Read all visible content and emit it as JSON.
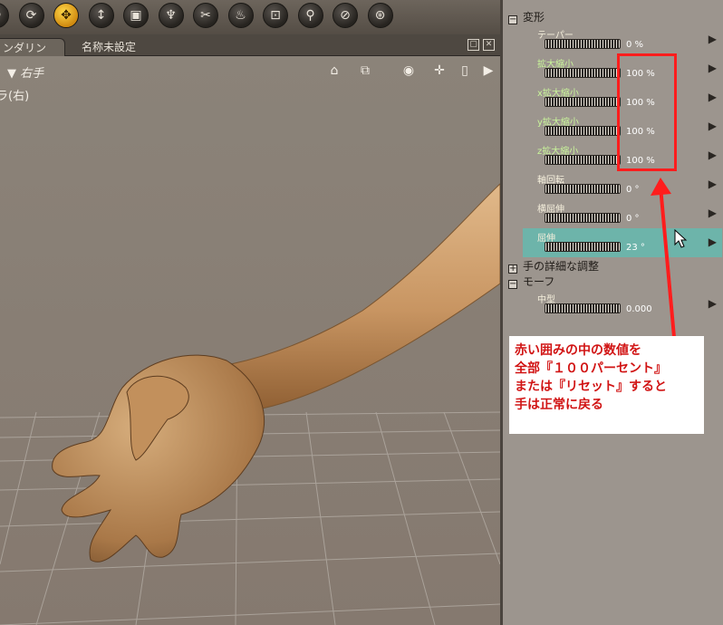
{
  "toolbar": {
    "tools": [
      {
        "icon": "rotate-icon",
        "glyph": "↻"
      },
      {
        "icon": "twist-icon",
        "glyph": "⟳"
      },
      {
        "icon": "translate-icon",
        "glyph": "✥"
      },
      {
        "icon": "translate-in-out-icon",
        "glyph": "↕"
      },
      {
        "icon": "scale-icon",
        "glyph": "▣"
      },
      {
        "icon": "taper-icon",
        "glyph": "♆"
      },
      {
        "icon": "chain-break-icon",
        "glyph": "✂"
      },
      {
        "icon": "color-icon",
        "glyph": "♨"
      },
      {
        "icon": "grouping-icon",
        "glyph": "⊡"
      },
      {
        "icon": "view-magnify-icon",
        "glyph": "⚲"
      },
      {
        "icon": "morph-brush-icon",
        "glyph": "⊘"
      },
      {
        "icon": "direct-manipulation-icon",
        "glyph": "⊛"
      }
    ],
    "active_index": 2
  },
  "tabs": {
    "render": "ンダリング",
    "unnamed": "名称未設定"
  },
  "viewport": {
    "figure_label": "右手",
    "camera_label": "ラ(右)"
  },
  "panel": {
    "groups": {
      "transform": "変形",
      "hand_detail": "手の詳細な調整",
      "morph": "モーフ"
    },
    "params": [
      {
        "name": "テーパー",
        "value": "0 %",
        "green": false,
        "selected": false
      },
      {
        "name": "拡大縮小",
        "value": "100 %",
        "green": true,
        "selected": false
      },
      {
        "name": "x拡大縮小",
        "value": "100 %",
        "green": true,
        "selected": false
      },
      {
        "name": "y拡大縮小",
        "value": "100 %",
        "green": true,
        "selected": false
      },
      {
        "name": "z拡大縮小",
        "value": "100 %",
        "green": true,
        "selected": false
      },
      {
        "name": "軸回転",
        "value": "0 °",
        "green": false,
        "selected": false
      },
      {
        "name": "横屈伸",
        "value": "0 °",
        "green": false,
        "selected": false
      },
      {
        "name": "屈伸",
        "value": "23 °",
        "green": false,
        "selected": true
      }
    ],
    "morph_param": {
      "name": "中型",
      "value": "0.000"
    }
  },
  "annotation": {
    "lines": [
      "赤い囲みの中の数値を",
      "全部『１００パーセント』",
      "または『リセット』すると",
      "手は正常に戻る"
    ]
  },
  "colors": {
    "highlight": "#ff1d1d",
    "selected_param": "#6db4aa",
    "active_tool": "#ffd84a"
  }
}
